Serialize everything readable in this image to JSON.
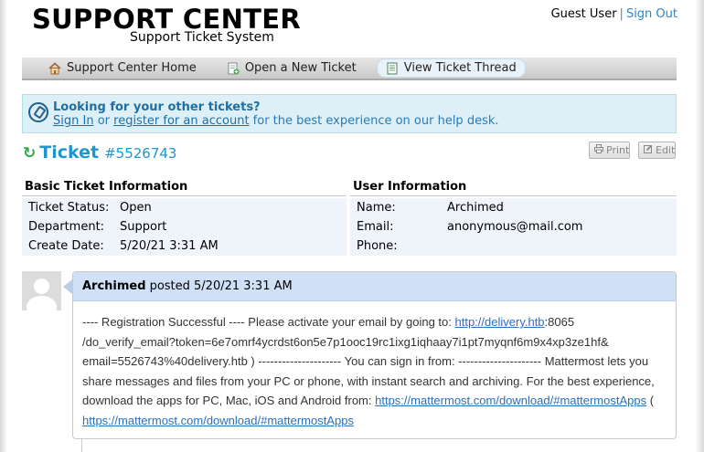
{
  "header": {
    "logo_main": "SUPPORT CENTER",
    "logo_sub": "Support Ticket System",
    "user_label": "Guest User",
    "separator": "|",
    "signout_label": "Sign Out"
  },
  "nav": {
    "items": [
      {
        "label": "Support Center Home",
        "icon": "home-icon",
        "active": false
      },
      {
        "label": "Open a New Ticket",
        "icon": "new-ticket-icon",
        "active": false
      },
      {
        "label": "View Ticket Thread",
        "icon": "document-icon",
        "active": true
      }
    ]
  },
  "banner": {
    "title": "Looking for your other tickets?",
    "signin_label": "Sign In",
    "or_text": " or ",
    "register_label": "register for an account",
    "tail_text": " for the best experience on our help desk."
  },
  "ticket": {
    "word": "Ticket",
    "number": "#5526743",
    "print_label": "Print",
    "edit_label": "Edit"
  },
  "basic_info": {
    "heading": "Basic Ticket Information",
    "rows": [
      {
        "key": "Ticket Status:",
        "value": "Open"
      },
      {
        "key": "Department:",
        "value": "Support"
      },
      {
        "key": "Create Date:",
        "value": "5/20/21 3:31 AM"
      }
    ]
  },
  "user_info": {
    "heading": "User Information",
    "rows": [
      {
        "key": "Name:",
        "value": "Archimed"
      },
      {
        "key": "Email:",
        "value": "anonymous@mail.com"
      },
      {
        "key": "Phone:",
        "value": ""
      }
    ]
  },
  "thread": {
    "author": "Archimed",
    "posted_text": "posted 5/20/21 3:31 AM",
    "body": {
      "t1": "---- Registration Successful ---- Please activate your email by going to: ",
      "link1": "http://delivery.htb",
      "t2": ":8065",
      "t3": "/do_verify_email?token=6e7omrf4ycrdst6on5e7p1ooc19rc1ixg1iqhaay7i1pt7myqnf6m9x4xp3ze1hf&",
      "t4": "email=5526743%40delivery.htb ) --------------------- You can sign in from: --------------------- Mattermost lets you share messages and files from your PC or phone, with instant search and archiving. For the best experience, download the apps for PC, Mac, iOS and Android from: ",
      "link2": "https://mattermost.com/download/#mattermostApps",
      "t5": " (",
      "link3": "https://mattermost.com/download/#mattermostApps"
    }
  },
  "colors": {
    "accent": "#1f95cf",
    "banner_bg": "#ddf0f7",
    "post_header_bg": "#cfe0f7",
    "refresh_green": "#2fa84a"
  }
}
